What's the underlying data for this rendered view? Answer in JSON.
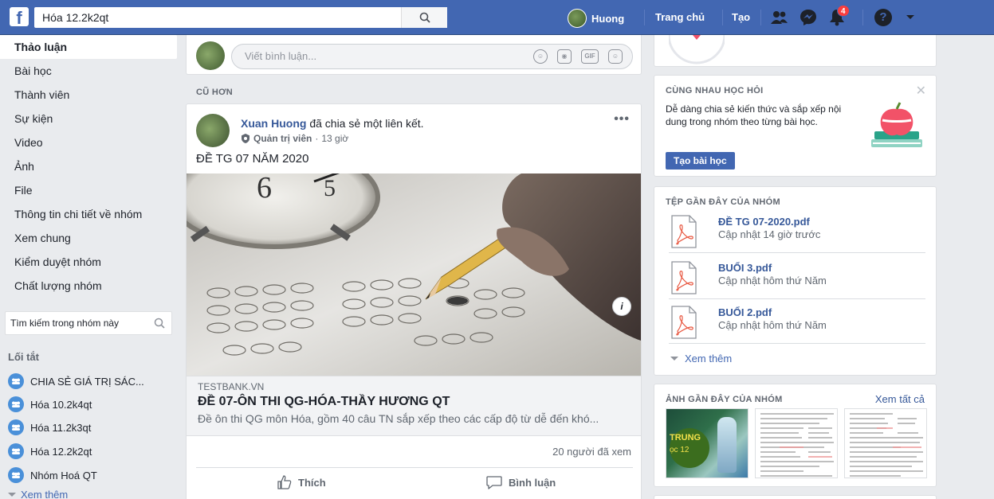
{
  "topbar": {
    "logo": "f",
    "search_value": "Hóa 12.2k2qt",
    "user_name": "Huong",
    "home_label": "Trang chủ",
    "create_label": "Tạo",
    "notification_count": "4",
    "help_glyph": "?"
  },
  "leftnav": {
    "items": [
      {
        "label": "Thảo luận"
      },
      {
        "label": "Bài học"
      },
      {
        "label": "Thành viên"
      },
      {
        "label": "Sự kiện"
      },
      {
        "label": "Video"
      },
      {
        "label": "Ảnh"
      },
      {
        "label": "File"
      },
      {
        "label": "Thông tin chi tiết về nhóm"
      },
      {
        "label": "Xem chung"
      },
      {
        "label": "Kiểm duyệt nhóm"
      },
      {
        "label": "Chất lượng nhóm"
      }
    ],
    "search_placeholder": "Tìm kiếm trong nhóm này",
    "shortcuts_title": "Lối tắt",
    "shortcuts": [
      {
        "label": "CHIA SẺ GIÁ TRỊ SÁC..."
      },
      {
        "label": "Hóa 10.2k4qt"
      },
      {
        "label": "Hóa 11.2k3qt"
      },
      {
        "label": "Hóa 12.2k2qt"
      },
      {
        "label": "Nhóm Hoá QT"
      }
    ],
    "more_label": "Xem thêm"
  },
  "comment_box": {
    "placeholder": "Viết bình luận...",
    "gif_label": "GIF"
  },
  "feed": {
    "older_label": "CŨ HƠN",
    "post": {
      "author": "Xuan Huong",
      "action_text": "đã chia sẻ một liên kết.",
      "role": "Quản trị viên",
      "separator": "·",
      "time": "13 giờ",
      "text": "ĐỀ TG 07 NĂM 2020",
      "link": {
        "domain": "TESTBANK.VN",
        "title": "ĐỀ 07-ÔN THI QG-HÓA-THẦY HƯƠNG QT",
        "description": "Đề ôn thi QG môn Hóa, gồm 40 câu TN sắp xếp theo các cấp độ từ dễ đến khó..."
      },
      "views": "20 người đã xem",
      "like_label": "Thích",
      "comment_label": "Bình luận"
    }
  },
  "right": {
    "learn": {
      "title": "CÙNG NHAU HỌC HỎI",
      "text": "Dễ dàng chia sẻ kiến thức và sắp xếp nội dung trong nhóm theo từng bài học.",
      "button": "Tạo bài học"
    },
    "files": {
      "title": "TỆP GẦN ĐÂY CỦA NHÓM",
      "items": [
        {
          "name": "ĐỀ TG 07-2020.pdf",
          "updated": "Cập nhật 14 giờ trước"
        },
        {
          "name": "BUỔI 3.pdf",
          "updated": "Cập nhật hôm thứ Năm"
        },
        {
          "name": "BUỔI 2.pdf",
          "updated": "Cập nhật hôm thứ Năm"
        }
      ],
      "more_label": "Xem thêm"
    },
    "photos": {
      "title": "ẢNH GẦN ĐÂY CỦA NHÓM",
      "see_all": "Xem tất cả",
      "thumb1_text_a": "TRUNG",
      "thumb1_text_b": "ọc 12"
    }
  },
  "colors": {
    "brand": "#4267b2",
    "link": "#365899",
    "background": "#e9ebee",
    "notification": "#fa3e3e"
  }
}
